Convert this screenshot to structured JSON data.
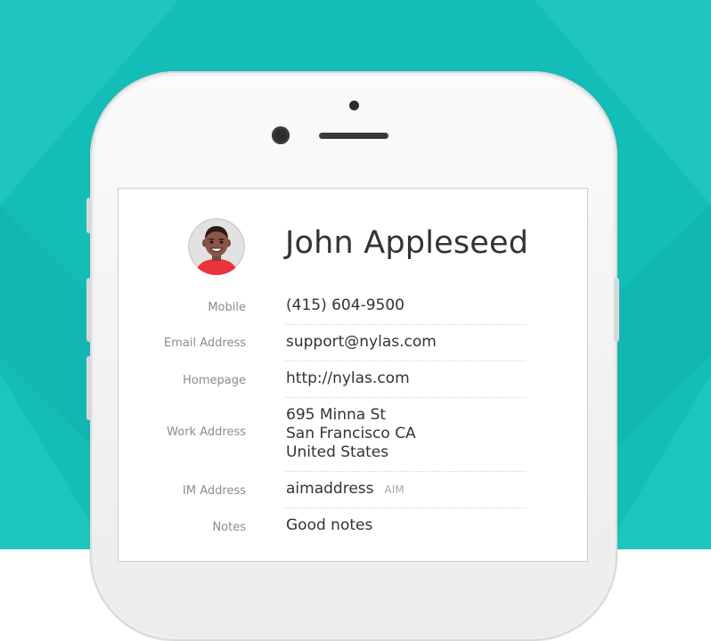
{
  "contact": {
    "name": "John Appleseed",
    "avatar_icon": "person-avatar-icon"
  },
  "fields": {
    "mobile": {
      "label": "Mobile",
      "value": "(415) 604-9500"
    },
    "email": {
      "label": "Email Address",
      "value": "support@nylas.com"
    },
    "homepage": {
      "label": "Homepage",
      "value": "http://nylas.com"
    },
    "work_address": {
      "label": "Work Address",
      "line1": "695 Minna St",
      "line2": "San Francisco CA",
      "line3": "United States"
    },
    "im_address": {
      "label": "IM Address",
      "value": "aimaddress",
      "service": "AIM"
    },
    "notes": {
      "label": "Notes",
      "value": "Good notes"
    }
  },
  "colors": {
    "background": "#13bdb8",
    "background_light": "#2fcfca",
    "phone_body": "#f5f5f5",
    "text_primary": "#333333",
    "text_label": "#8c8c8c",
    "avatar_shirt": "#e8343a"
  }
}
